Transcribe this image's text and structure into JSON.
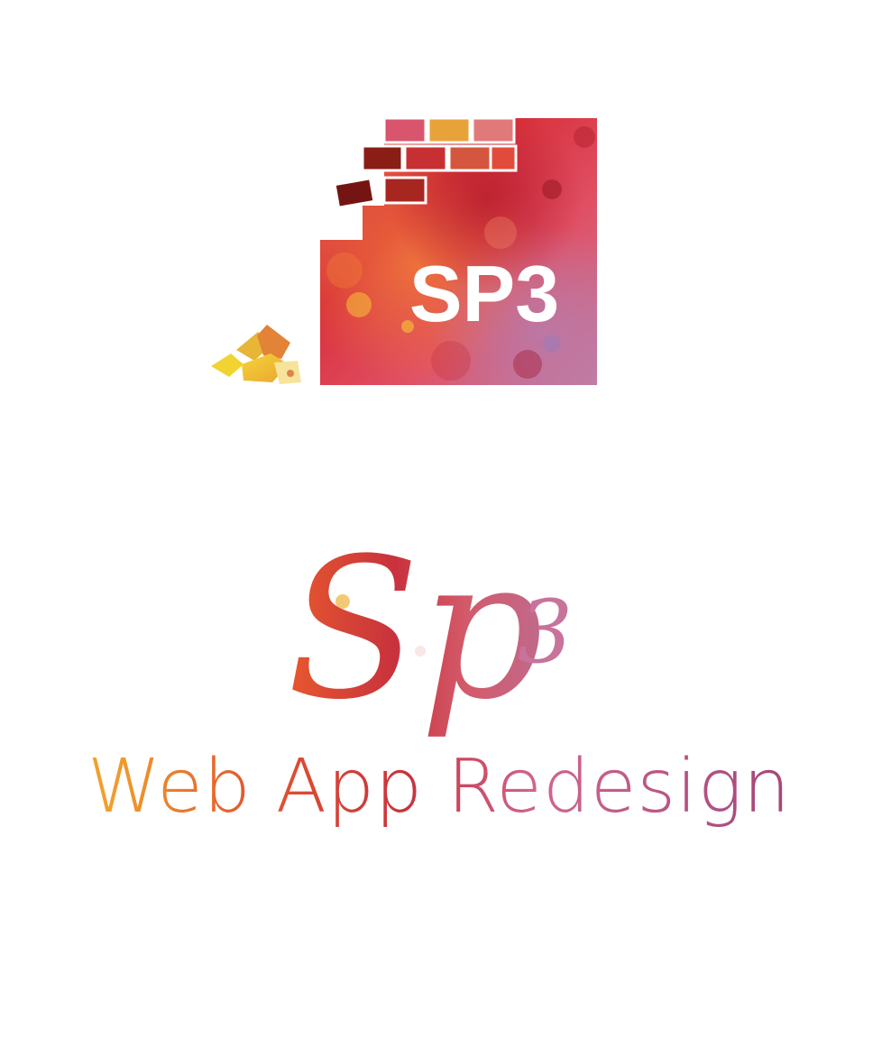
{
  "logo_mark": {
    "text": "SP3",
    "text_color": "#ffffff",
    "watercolor_colors": [
      "#c9232c",
      "#e0533a",
      "#f08a3b",
      "#d45a7a",
      "#b9709b",
      "#f2c33a",
      "#7a1a17"
    ]
  },
  "script_logo": {
    "wordmark_main": "Sp",
    "wordmark_super": "3",
    "tagline": "Web App Redesign",
    "gradient_colors": [
      "#f0a02d",
      "#e4552f",
      "#c8323d",
      "#d0668f",
      "#a8487b"
    ]
  }
}
